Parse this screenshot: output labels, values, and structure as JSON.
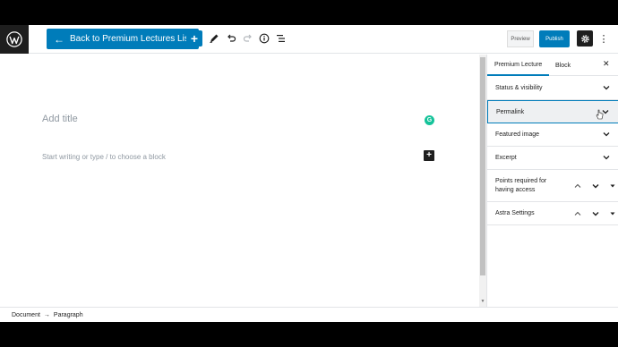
{
  "toolbar": {
    "logo_icon": "wordpress-logo-icon",
    "back_label": "Back to Premium Lectures List",
    "preview_label": "Preview",
    "publish_label": "Publish",
    "accent_color": "#007cba"
  },
  "editor": {
    "title_placeholder": "Add title",
    "block_placeholder": "Start writing or type / to choose a block"
  },
  "sidebar": {
    "tabs": [
      {
        "label": "Premium Lecture",
        "active": true
      },
      {
        "label": "Block",
        "active": false
      }
    ],
    "panels": [
      {
        "label": "Status & visibility"
      },
      {
        "label": "Permalink"
      },
      {
        "label": "Featured image"
      },
      {
        "label": "Excerpt"
      },
      {
        "label": "Points required for having access"
      },
      {
        "label": "Astra Settings"
      }
    ]
  },
  "footer": {
    "crumb_1": "Document",
    "separator": "→",
    "crumb_2": "Paragraph"
  }
}
